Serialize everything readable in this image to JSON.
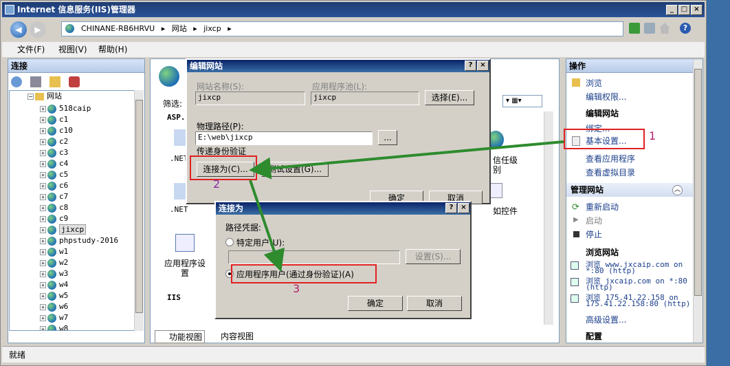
{
  "window": {
    "title": "Internet 信息服务(IIS)管理器",
    "controls": [
      "_",
      "□",
      "×"
    ]
  },
  "address": {
    "path": [
      "CHINANE-RB6HRVU",
      "网站",
      "jixcp"
    ],
    "separator": "▸"
  },
  "menu": [
    {
      "label": "文件(F)"
    },
    {
      "label": "视图(V)"
    },
    {
      "label": "帮助(H)"
    }
  ],
  "left_pane": {
    "header": "连接",
    "root_label": "网站",
    "sites": [
      "518caip",
      "c1",
      "c10",
      "c2",
      "c3",
      "c4",
      "c5",
      "c6",
      "c7",
      "c8",
      "c9",
      "jixcp",
      "phpstudy-2016",
      "w1",
      "w2",
      "w3",
      "w4",
      "w5",
      "w6",
      "w7",
      "w8"
    ],
    "selected": "jixcp"
  },
  "center": {
    "filter_label": "筛选:",
    "section_asp": "ASP.",
    "net_label_1": ".NET",
    "net_label_2": ".NET",
    "trust_label_1": "信任级",
    "trust_label_2": "别",
    "control_label": "如控件",
    "app_settings_1": "应用程序设",
    "app_settings_2": "置",
    "section_iis": "IIS",
    "view_tabs": [
      "功能视图",
      "内容视图"
    ]
  },
  "right_pane": {
    "header": "操作",
    "browse": "浏览",
    "edit_perm": "编辑权限...",
    "edit_site_hdr": "编辑网站",
    "bind": "绑定...",
    "basic_settings": "基本设置...",
    "view_apps": "查看应用程序",
    "view_vdirs": "查看虚拟目录",
    "manage_hdr": "管理网站",
    "restart": "重新启动",
    "start": "启动",
    "stop": "停止",
    "browse_site_hdr": "浏览网站",
    "browse_links": [
      {
        "l1": "浏览 www.jxcaip.com on",
        "l2": "*:80 (http)"
      },
      {
        "l1": "浏览 jxcaip.com on *:80",
        "l2": "(http)"
      },
      {
        "l1": "浏览 175.41.22.158 on",
        "l2": "175.41.22.158:80 (http)"
      }
    ],
    "advanced": "高级设置...",
    "config_hdr": "配置"
  },
  "edit_dialog": {
    "title": "编辑网站",
    "site_name_label": "网站名称(S):",
    "site_name": "jixcp",
    "app_pool_label": "应用程序池(L):",
    "app_pool": "jixcp",
    "select_btn": "选择(E)...",
    "phys_path_label": "物理路径(P):",
    "phys_path": "E:\\web\\jixcp",
    "browse_btn": "...",
    "pass_auth_label": "传递身份验证",
    "connect_as_btn": "连接为(C)...",
    "test_btn": "测试设置(G)...",
    "ok": "确定",
    "cancel": "取消"
  },
  "connect_dialog": {
    "title": "连接为",
    "path_cred_label": "路径凭据:",
    "specific_user": "特定用户(U):",
    "settings_btn": "设置(S)...",
    "app_user": "应用程序用户(通过身份验证)(A)",
    "ok": "确定",
    "cancel": "取消"
  },
  "annotations": {
    "n1": "1",
    "n2": "2",
    "n3": "3"
  },
  "annotation_colors": {
    "box": "#e02020",
    "arrow": "#2e8b2e",
    "number_1": "#b0206a",
    "number_2": "#8a2aa0",
    "number_3": "#b0206a"
  },
  "status": {
    "text": "就绪"
  },
  "help_glyph": "?"
}
